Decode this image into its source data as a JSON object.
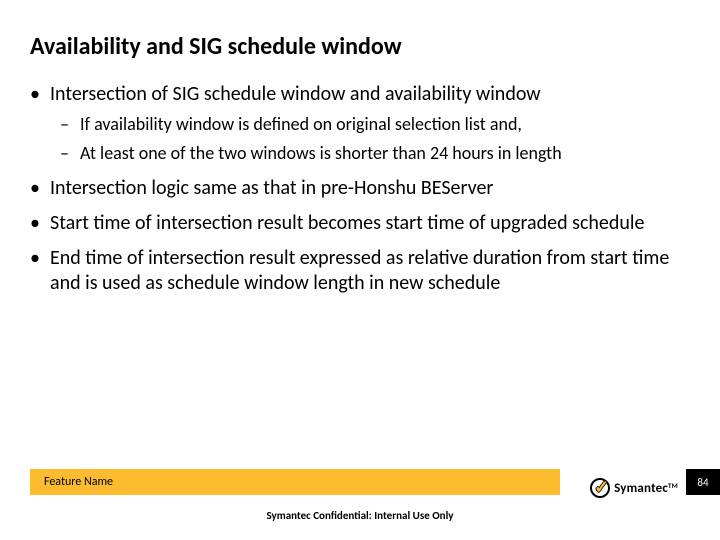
{
  "title": "Availability and SIG schedule window",
  "bullets": {
    "b0": "Intersection of SIG schedule window and availability window",
    "b0_sub": {
      "s0": "If availability window is defined on original selection list and,",
      "s1": "At least one of the two windows is shorter than 24 hours in length"
    },
    "b1": "Intersection logic same as that in pre-Honshu BEServer",
    "b2": "Start time of intersection result becomes start time of upgraded schedule",
    "b3": "End time of intersection result expressed as relative duration from start time and is used as schedule window length in new schedule"
  },
  "footer": {
    "feature_name": "Feature Name",
    "page_number": "84",
    "brand": "Symantec",
    "tm": "TM",
    "confidential": "Symantec Confidential:  Internal Use Only"
  }
}
